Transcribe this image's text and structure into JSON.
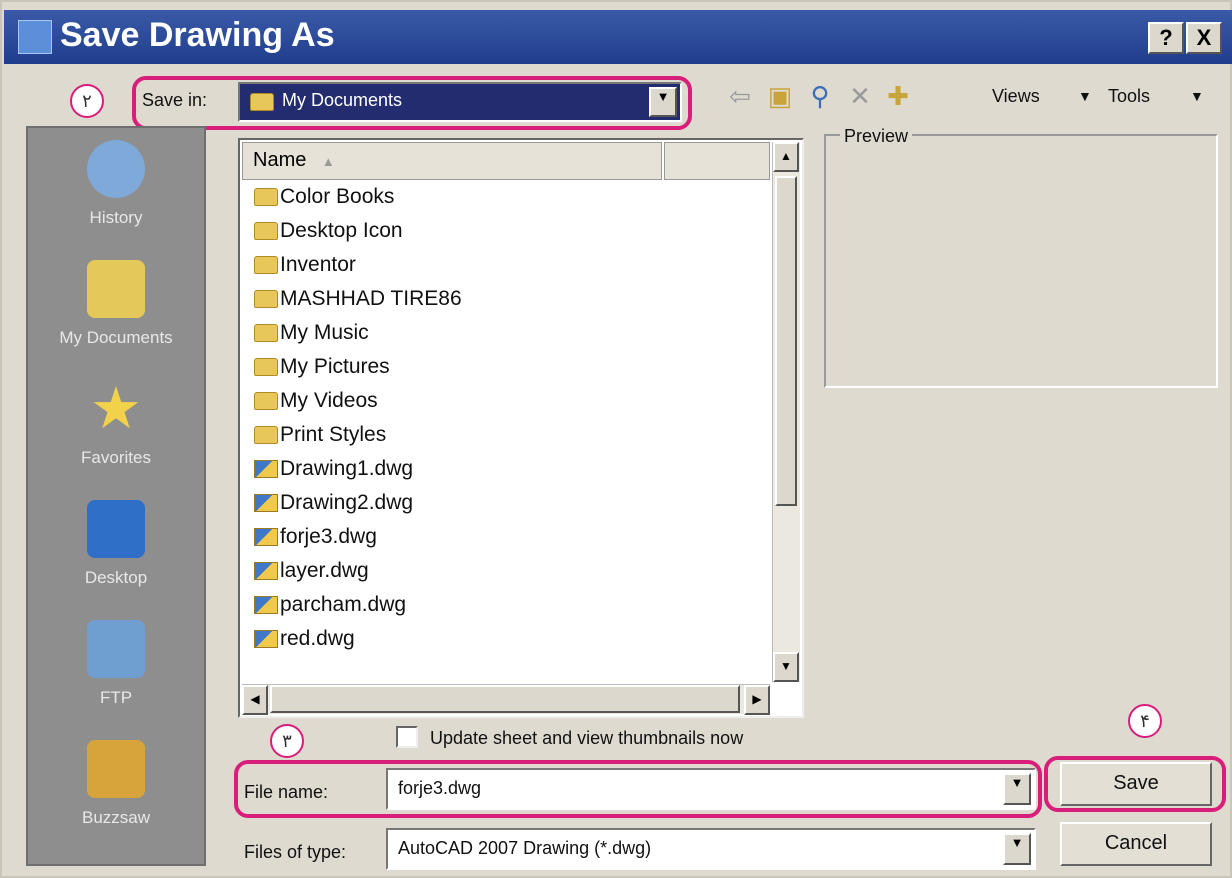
{
  "window": {
    "title": "Save Drawing As",
    "help_btn": "?",
    "close_btn": "X"
  },
  "callouts": {
    "c2": "٢",
    "c3": "٣",
    "c4": "۴"
  },
  "save_in": {
    "label": "Save in:",
    "value": "My Documents"
  },
  "toolbar": {
    "views": "Views",
    "tools": "Tools",
    "arrow": "▼"
  },
  "places": [
    {
      "label": "History",
      "icon": "history-icon"
    },
    {
      "label": "My Documents",
      "icon": "my-documents-icon"
    },
    {
      "label": "Favorites",
      "icon": "favorites-icon"
    },
    {
      "label": "Desktop",
      "icon": "desktop-icon"
    },
    {
      "label": "FTP",
      "icon": "ftp-icon"
    },
    {
      "label": "Buzzsaw",
      "icon": "buzzsaw-icon"
    }
  ],
  "file_list": {
    "column": "Name",
    "items": [
      {
        "name": "Color Books",
        "type": "folder"
      },
      {
        "name": "Desktop Icon",
        "type": "folder"
      },
      {
        "name": "Inventor",
        "type": "folder"
      },
      {
        "name": "MASHHAD TIRE86",
        "type": "folder"
      },
      {
        "name": "My Music",
        "type": "folder"
      },
      {
        "name": "My Pictures",
        "type": "folder"
      },
      {
        "name": "My Videos",
        "type": "folder"
      },
      {
        "name": "Print Styles",
        "type": "folder"
      },
      {
        "name": "Drawing1.dwg",
        "type": "dwg"
      },
      {
        "name": "Drawing2.dwg",
        "type": "dwg"
      },
      {
        "name": "forje3.dwg",
        "type": "dwg"
      },
      {
        "name": "layer.dwg",
        "type": "dwg"
      },
      {
        "name": "parcham.dwg",
        "type": "dwg"
      },
      {
        "name": "red.dwg",
        "type": "dwg"
      }
    ]
  },
  "preview": {
    "label": "Preview"
  },
  "thumbnails_checkbox": {
    "label": "Update sheet and view thumbnails now",
    "checked": false
  },
  "file_name": {
    "label": "File name:",
    "value": "forje3.dwg"
  },
  "file_type": {
    "label": "Files of type:",
    "value": "AutoCAD 2007 Drawing (*.dwg)"
  },
  "buttons": {
    "save": "Save",
    "cancel": "Cancel"
  },
  "colors": {
    "highlight": "#d81d7a",
    "title_bar": "#1f3d8c"
  }
}
